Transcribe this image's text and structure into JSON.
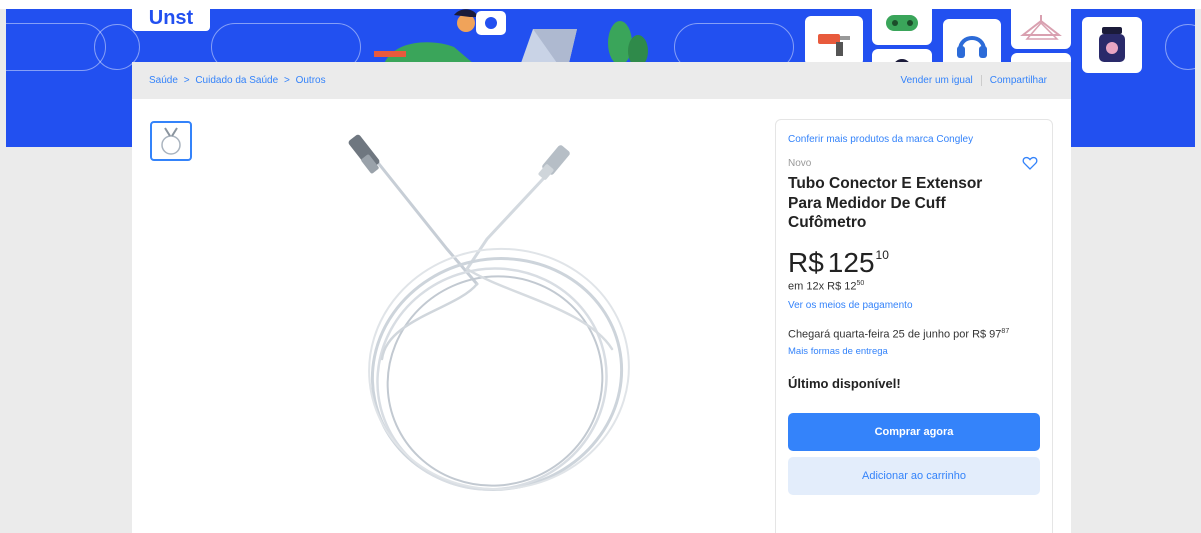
{
  "banner": {
    "logo_text": "Unst",
    "colors": {
      "background": "#2250f0",
      "accent_green": "#3aa55a"
    }
  },
  "breadcrumb": {
    "items": [
      "Saúde",
      "Cuidado da Saúde",
      "Outros"
    ],
    "separator": ">"
  },
  "actions": {
    "sell_label": "Vender um igual",
    "share_label": "Compartilhar"
  },
  "product": {
    "brand_link": "Conferir mais produtos da marca Congley",
    "condition": "Novo",
    "title": "Tubo Conector E Extensor Para Medidor De Cuff Cufômetro",
    "price": {
      "currency": "R$",
      "integer": "125",
      "cents": "10"
    },
    "installments": {
      "prefix": "em 12x R$ 12",
      "cents": "50"
    },
    "payment_link": "Ver os meios de pagamento",
    "delivery": {
      "text": "Chegará quarta-feira 25 de junho por R$ 97",
      "cents": "87"
    },
    "delivery_link": "Mais formas de entrega",
    "stock": "Último disponível!",
    "buy_label": "Comprar agora",
    "cart_label": "Adicionar ao carrinho"
  },
  "colors": {
    "link": "#3483fa",
    "primary_button": "#3483fa",
    "secondary_button": "#e3edfb"
  }
}
